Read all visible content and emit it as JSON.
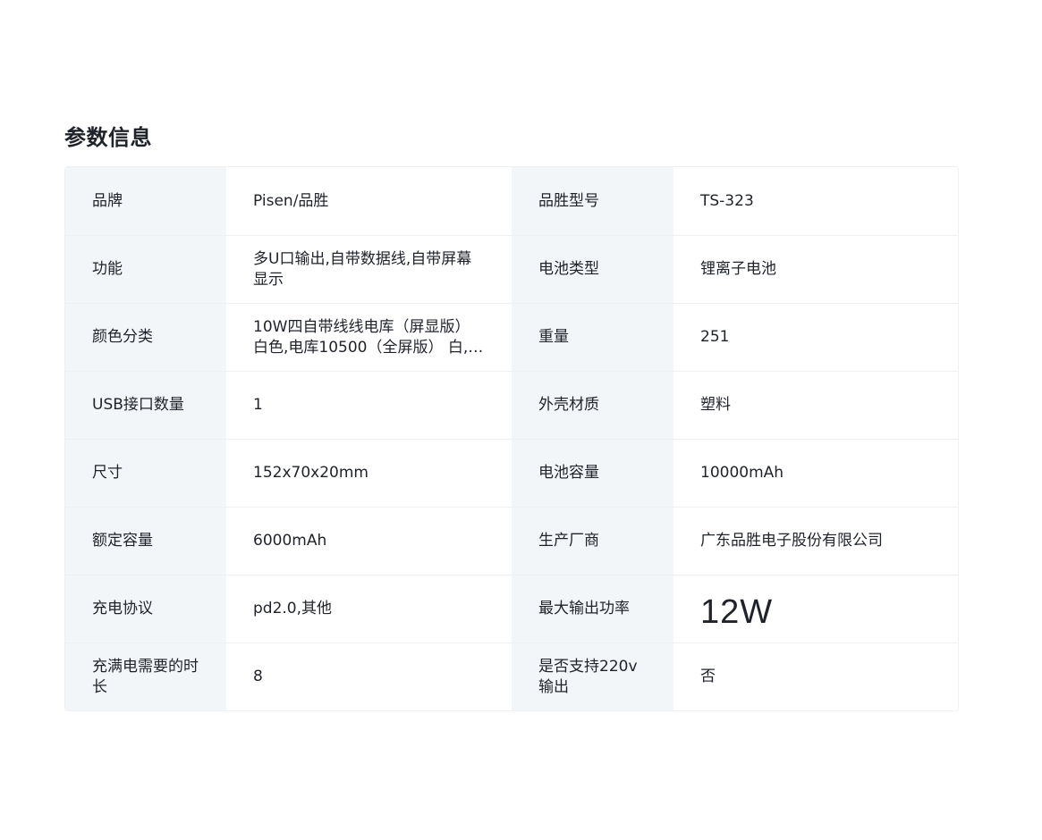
{
  "section_title": "参数信息",
  "rows": [
    {
      "label1": "品牌",
      "value1": "Pisen/品胜",
      "label2": "品胜型号",
      "value2": "TS-323"
    },
    {
      "label1": "功能",
      "value1": "多U口输出,自带数据线,自带屏幕显示",
      "label2": "电池类型",
      "value2": "锂离子电池"
    },
    {
      "label1": "颜色分类",
      "value1": "10W四自带线线电库（屏显版）白色,电库10500（全屏版） 白,…",
      "label2": "重量",
      "value2": "251"
    },
    {
      "label1": "USB接口数量",
      "value1": "1",
      "label2": "外壳材质",
      "value2": "塑料"
    },
    {
      "label1": "尺寸",
      "value1": "152x70x20mm",
      "label2": "电池容量",
      "value2": "10000mAh"
    },
    {
      "label1": "额定容量",
      "value1": "6000mAh",
      "label2": "生产厂商",
      "value2": "广东品胜电子股份有限公司"
    },
    {
      "label1": "充电协议",
      "value1": "pd2.0,其他",
      "label2": "最大输出功率",
      "value2": "12W"
    },
    {
      "label1": "充满电需要的时长",
      "value1": "8",
      "label2": "是否支持220v输出",
      "value2": "否"
    }
  ]
}
